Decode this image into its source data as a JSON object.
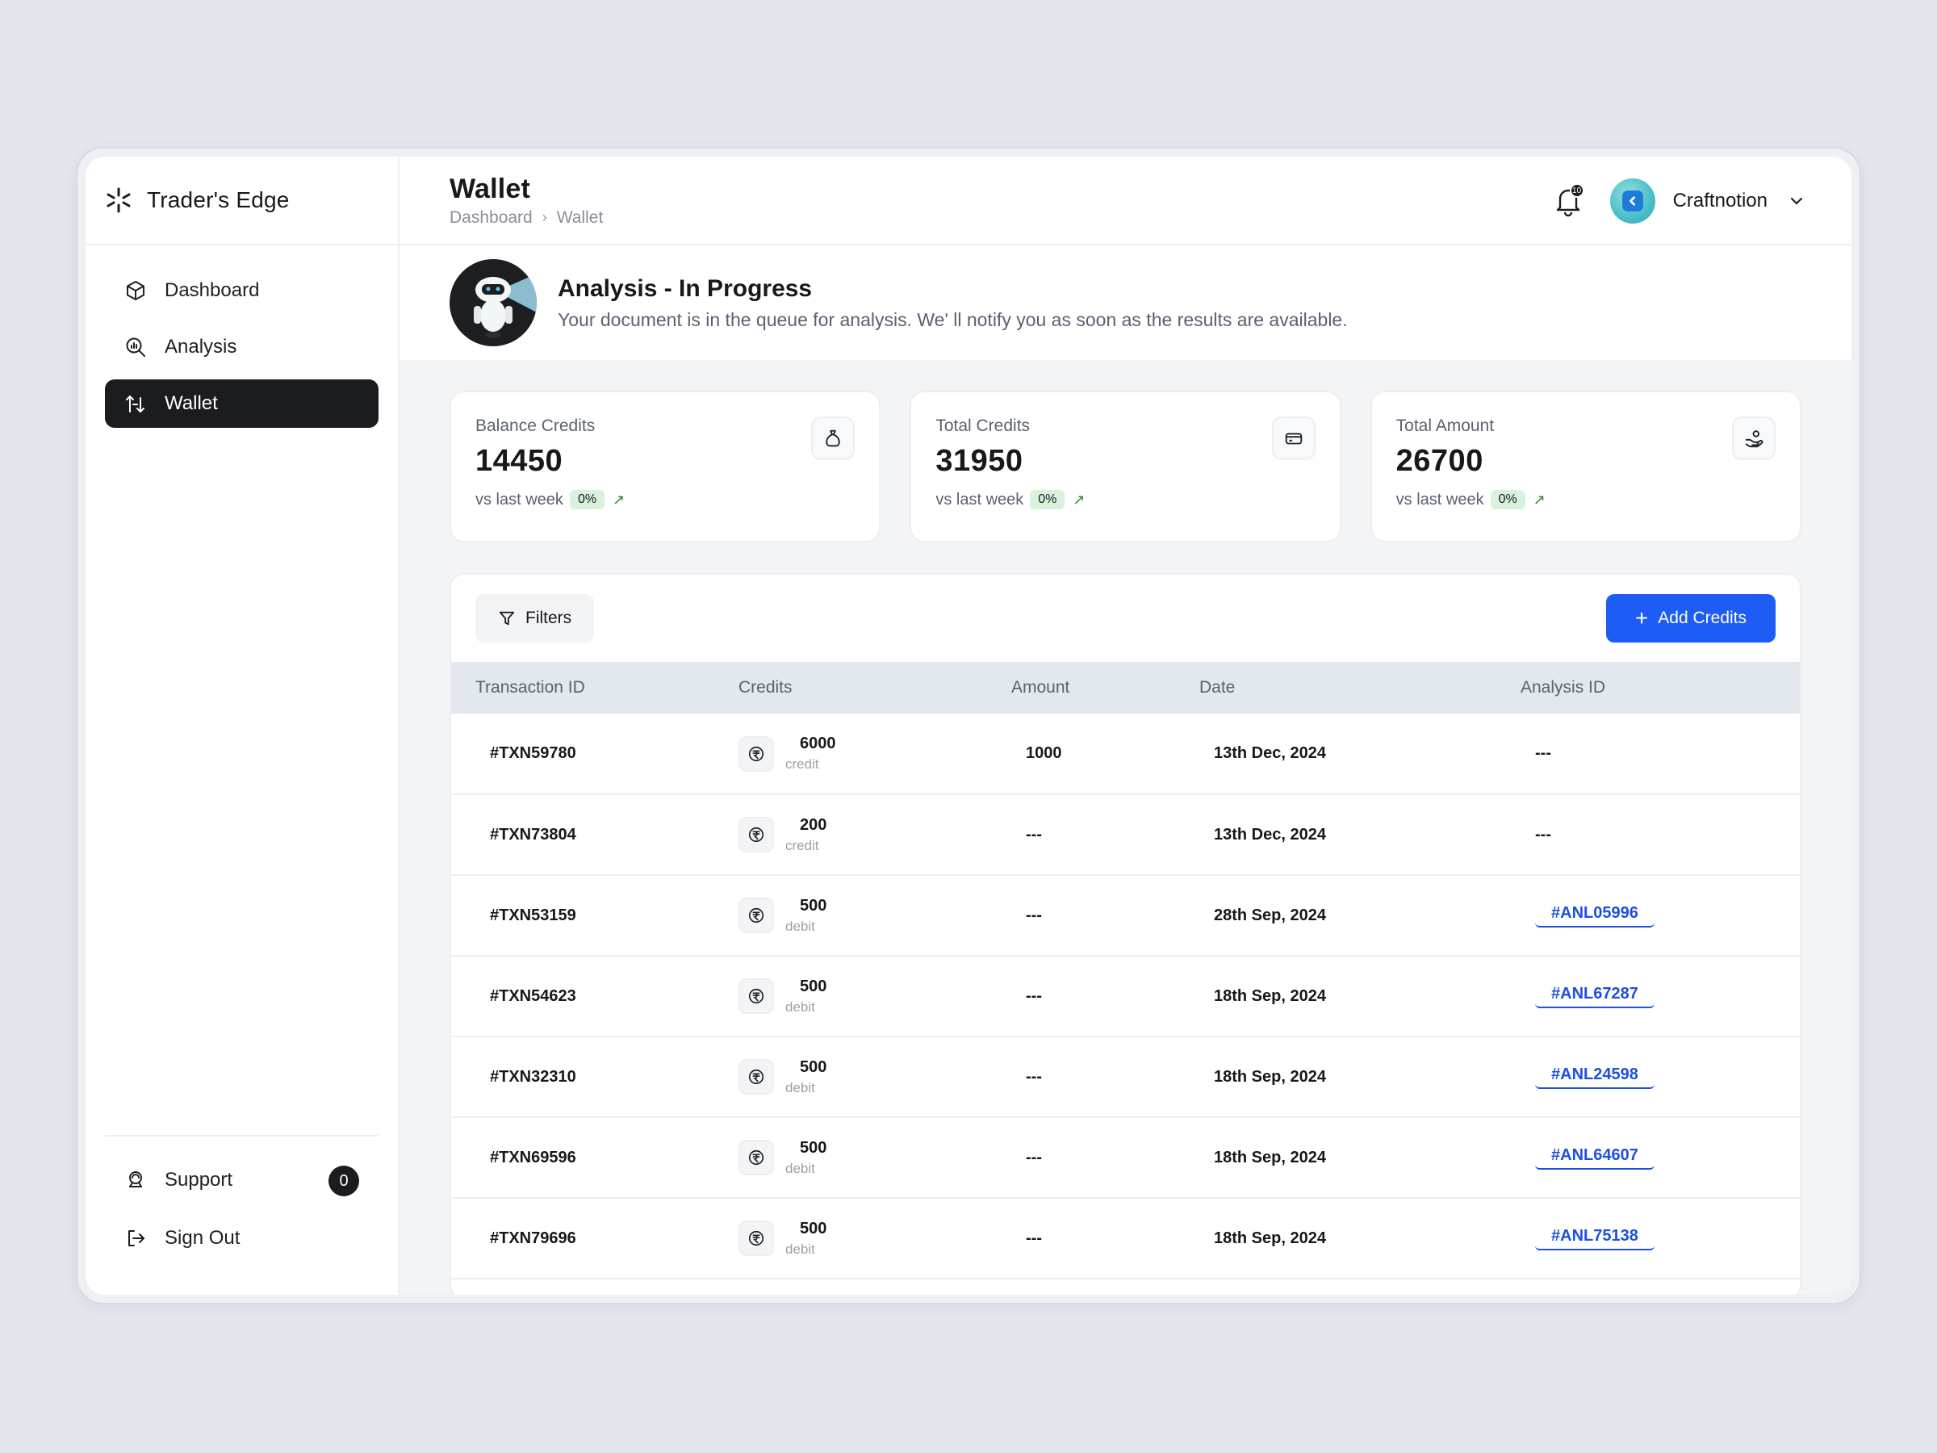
{
  "brand": {
    "name": "Trader's Edge"
  },
  "sidebar": {
    "items": [
      {
        "label": "Dashboard",
        "icon": "cube-icon",
        "active": false
      },
      {
        "label": "Analysis",
        "icon": "magnifier-chart-icon",
        "active": false
      },
      {
        "label": "Wallet",
        "icon": "wallet-transfer-icon",
        "active": true
      }
    ],
    "bottom": [
      {
        "label": "Support",
        "icon": "support-icon",
        "badge": "0"
      },
      {
        "label": "Sign Out",
        "icon": "sign-out-icon"
      }
    ]
  },
  "header": {
    "title": "Wallet",
    "breadcrumb": [
      "Dashboard",
      "Wallet"
    ],
    "notifications": "10",
    "user": "Craftnotion"
  },
  "banner": {
    "title": "Analysis - In Progress",
    "description": "Your document is in the queue for analysis. We' ll notify you as soon as the results are available."
  },
  "stats": [
    {
      "label": "Balance Credits",
      "value": "14450",
      "foot": "vs last week",
      "pct": "0%",
      "icon": "money-bag-icon"
    },
    {
      "label": "Total Credits",
      "value": "31950",
      "foot": "vs last week",
      "pct": "0%",
      "icon": "card-icon"
    },
    {
      "label": "Total Amount",
      "value": "26700",
      "foot": "vs last week",
      "pct": "0%",
      "icon": "hand-coin-icon"
    }
  ],
  "toolbar": {
    "filters_label": "Filters",
    "add_label": "Add Credits"
  },
  "table": {
    "columns": [
      "Transaction ID",
      "Credits",
      "Amount",
      "Date",
      "Analysis ID"
    ],
    "rows": [
      {
        "txn": "#TXN59780",
        "credits": "6000",
        "type": "credit",
        "amount": "1000",
        "date": "13th Dec, 2024",
        "analysis": "---"
      },
      {
        "txn": "#TXN73804",
        "credits": "200",
        "type": "credit",
        "amount": "---",
        "date": "13th Dec, 2024",
        "analysis": "---"
      },
      {
        "txn": "#TXN53159",
        "credits": "500",
        "type": "debit",
        "amount": "---",
        "date": "28th Sep, 2024",
        "analysis": "#ANL05996"
      },
      {
        "txn": "#TXN54623",
        "credits": "500",
        "type": "debit",
        "amount": "---",
        "date": "18th Sep, 2024",
        "analysis": "#ANL67287"
      },
      {
        "txn": "#TXN32310",
        "credits": "500",
        "type": "debit",
        "amount": "---",
        "date": "18th Sep, 2024",
        "analysis": "#ANL24598"
      },
      {
        "txn": "#TXN69596",
        "credits": "500",
        "type": "debit",
        "amount": "---",
        "date": "18th Sep, 2024",
        "analysis": "#ANL64607"
      },
      {
        "txn": "#TXN79696",
        "credits": "500",
        "type": "debit",
        "amount": "---",
        "date": "18th Sep, 2024",
        "analysis": "#ANL75138"
      }
    ]
  },
  "colors": {
    "accent": "#1d5cf5",
    "dark": "#1b1c1f",
    "success_bg": "#d9f2dc",
    "link": "#1d4fe0"
  }
}
